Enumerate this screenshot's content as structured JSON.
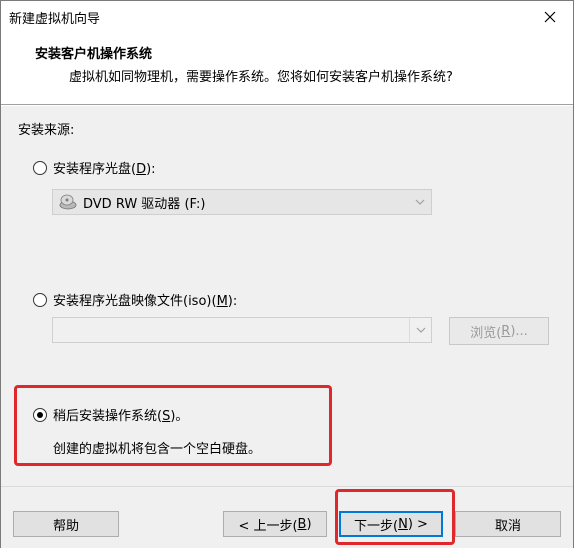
{
  "window": {
    "title": "新建虚拟机向导"
  },
  "header": {
    "title": "安装客户机操作系统",
    "subtitle": "虚拟机如同物理机，需要操作系统。您将如何安装客户机操作系统?"
  },
  "install_source": {
    "label": "安装来源:",
    "options": [
      {
        "label_pre": "安装程序光盘(",
        "mnemonic": "D",
        "label_post": "):",
        "selected": false
      },
      {
        "label_pre": "安装程序光盘映像文件(iso)(",
        "mnemonic": "M",
        "label_post": "):",
        "selected": false
      },
      {
        "label_pre": "稍后安装操作系统(",
        "mnemonic": "S",
        "label_post": ")。",
        "selected": true
      }
    ],
    "drive_select": {
      "value": "DVD RW 驱动器 (F:)",
      "icon": "dvd-drive-icon"
    },
    "iso_path": {
      "value": ""
    },
    "browse": {
      "pre": "浏览(",
      "mnemonic": "R",
      "post": ")..."
    },
    "later_hint": "创建的虚拟机将包含一个空白硬盘。"
  },
  "footer": {
    "help": "帮助",
    "back": {
      "pre": "< 上一步(",
      "mnemonic": "B",
      "post": ")"
    },
    "next": {
      "pre": "下一步(",
      "mnemonic": "N",
      "post": ") >"
    },
    "cancel": "取消"
  },
  "annotation_color": "#e0282c"
}
